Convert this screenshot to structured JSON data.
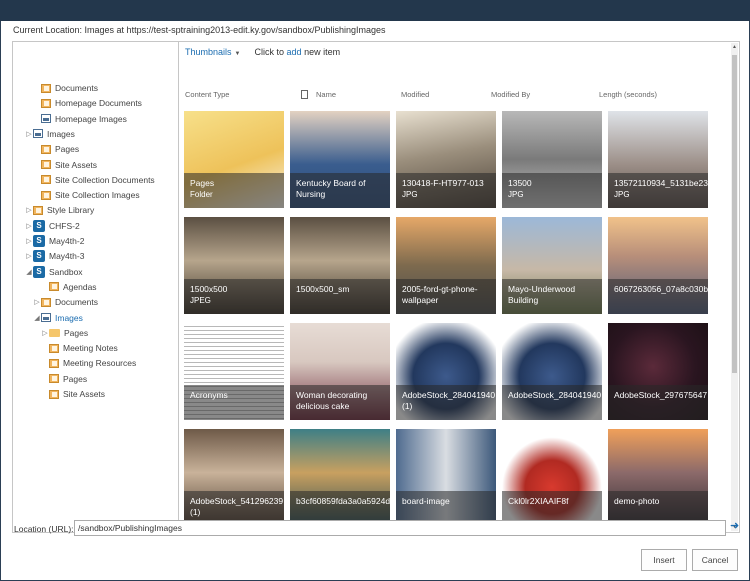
{
  "header": {
    "current_location": "Current Location: Images at https://test-sptraining2013-edit.ky.gov/sandbox/PublishingImages"
  },
  "tree": [
    {
      "label": "Documents",
      "icon": "document-library-icon",
      "exp": ""
    },
    {
      "label": "Homepage Documents",
      "icon": "document-library-icon",
      "exp": ""
    },
    {
      "label": "Homepage Images",
      "icon": "image-library-icon",
      "exp": ""
    },
    {
      "label": "Images",
      "icon": "image-library-icon",
      "exp": "▷"
    },
    {
      "label": "Pages",
      "icon": "document-library-icon",
      "exp": ""
    },
    {
      "label": "Site Assets",
      "icon": "document-library-icon",
      "exp": ""
    },
    {
      "label": "Site Collection Documents",
      "icon": "document-library-icon",
      "exp": ""
    },
    {
      "label": "Site Collection Images",
      "icon": "document-library-icon",
      "exp": ""
    },
    {
      "label": "Style Library",
      "icon": "document-library-icon",
      "exp": "▷"
    },
    {
      "label": "CHFS-2",
      "icon": "sharepoint-site-icon",
      "exp": "▷"
    },
    {
      "label": "May4th-2",
      "icon": "sharepoint-site-icon",
      "exp": "▷"
    },
    {
      "label": "May4th-3",
      "icon": "sharepoint-site-icon",
      "exp": "▷"
    },
    {
      "label": "Sandbox",
      "icon": "sharepoint-site-icon",
      "exp": "◢"
    },
    {
      "label": "Agendas",
      "icon": "document-library-icon",
      "exp": ""
    },
    {
      "label": "Documents",
      "icon": "document-library-icon",
      "exp": "▷"
    },
    {
      "label": "Images",
      "icon": "image-library-icon",
      "exp": "◢",
      "selected": true
    },
    {
      "label": "Pages",
      "icon": "folder-icon",
      "exp": "▷"
    },
    {
      "label": "Meeting Notes",
      "icon": "document-library-icon",
      "exp": ""
    },
    {
      "label": "Meeting Resources",
      "icon": "document-library-icon",
      "exp": ""
    },
    {
      "label": "Pages",
      "icon": "document-library-icon",
      "exp": ""
    },
    {
      "label": "Site Assets",
      "icon": "document-library-icon",
      "exp": ""
    }
  ],
  "toolbar": {
    "view": "Thumbnails",
    "click_to": "Click to",
    "add": "add",
    "new_item": "new item"
  },
  "columns": [
    "Content Type",
    "Name",
    "Modified",
    "Modified By",
    "Length (seconds)"
  ],
  "tiles": [
    {
      "name": "Pages",
      "sub": "Folder",
      "bg": "linear-gradient(160deg,#f7e08a 0%,#eec25a 55%,#f8f4ec 100%)"
    },
    {
      "name": "Kentucky Board of Nursing",
      "sub": "",
      "bg": "linear-gradient(180deg,#e3d2c2 0%,#3a5d8e 55%,#2f4f7e 100%)"
    },
    {
      "name": "130418-F-HT977-013",
      "sub": "JPG",
      "bg": "linear-gradient(170deg,#e8e0d0 0%,#9a8e7c 45%,#4c4238 100%)"
    },
    {
      "name": "13500",
      "sub": "JPG",
      "bg": "linear-gradient(180deg,#b8b8b8 0%,#7a7a7a 50%,#c8c8c8 100%)"
    },
    {
      "name": "13572110934_5131be23",
      "sub": "JPG",
      "bg": "linear-gradient(180deg,#dfe3e8 0%,#9c8f88 55%,#5b4f4b 100%)"
    },
    {
      "name": "1500x500",
      "sub": "JPEG",
      "bg": "linear-gradient(180deg,#5b4f42 0%,#b6a58c 45%,#3a3228 100%)"
    },
    {
      "name": "1500x500_sm",
      "sub": "",
      "bg": "linear-gradient(180deg,#5b4f42 0%,#b6a58c 45%,#3a3228 100%)"
    },
    {
      "name": "2005-ford-gt-phone-wallpaper",
      "sub": "",
      "bg": "linear-gradient(180deg,#e6a868 0%,#7d6a4e 50%,#4d4d4d 100%)"
    },
    {
      "name": "Mayo-Underwood Building",
      "sub": "",
      "bg": "linear-gradient(180deg,#9cb8d8 0%,#c7b8a6 55%,#6c7a4e 100%)"
    },
    {
      "name": "6067263056_07a8c030b",
      "sub": "",
      "bg": "linear-gradient(180deg,#f1c28a 0%,#b88f7a 40%,#4d5a78 100%)"
    },
    {
      "name": "Acronyms",
      "sub": "",
      "bg": "repeating-linear-gradient(180deg,#ffffff 0px,#ffffff 3px,#b8b8b8 3px,#b8b8b8 4px)"
    },
    {
      "name": "Woman decorating delicious cake",
      "sub": "",
      "bg": "linear-gradient(180deg,#e7dcd5 0%,#d8c8c0 40%,#6f2d3e 100%)"
    },
    {
      "name": "AdobeStock_284041940 (1)",
      "sub": "",
      "bg": "radial-gradient(circle at 50% 55%,#3d5a8c 0%,#22385e 45%,#ffffff 80%)"
    },
    {
      "name": "AdobeStock_284041940",
      "sub": "",
      "bg": "radial-gradient(circle at 50% 55%,#3d5a8c 0%,#22385e 45%,#ffffff 80%)"
    },
    {
      "name": "AdobeStock_297675647",
      "sub": "",
      "bg": "radial-gradient(circle at 45% 45%,#5b2a3a 0%,#2a1520 55%,#1b1014 100%)"
    },
    {
      "name": "AdobeStock_541296239 (1)",
      "sub": "",
      "bg": "linear-gradient(180deg,#6e5a48 0%,#c9b29a 45%,#4b3c30 100%)"
    },
    {
      "name": "b3cf60859fda3a0a5924d",
      "sub": "",
      "bg": "linear-gradient(180deg,#3e7f86 0%,#c8a060 45%,#2d4d52 100%)"
    },
    {
      "name": "board-image",
      "sub": "",
      "bg": "linear-gradient(90deg,#4f6b8f 0%,#d9dde2 50%,#3c587a 100%)"
    },
    {
      "name": "Ckl0lr2XIAAIF8f",
      "sub": "",
      "bg": "radial-gradient(circle at 50% 60%,#d83a2e 0%,#b12a22 35%,#ffffff 65%)"
    },
    {
      "name": "demo-photo",
      "sub": "",
      "bg": "linear-gradient(180deg,#f0a05a 0%,#8c6a6a 45%,#2e2a30 100%)"
    }
  ],
  "footer": {
    "location_label": "Location (URL):",
    "location_value": "/sandbox/PublishingImages",
    "insert": "Insert",
    "cancel": "Cancel"
  }
}
